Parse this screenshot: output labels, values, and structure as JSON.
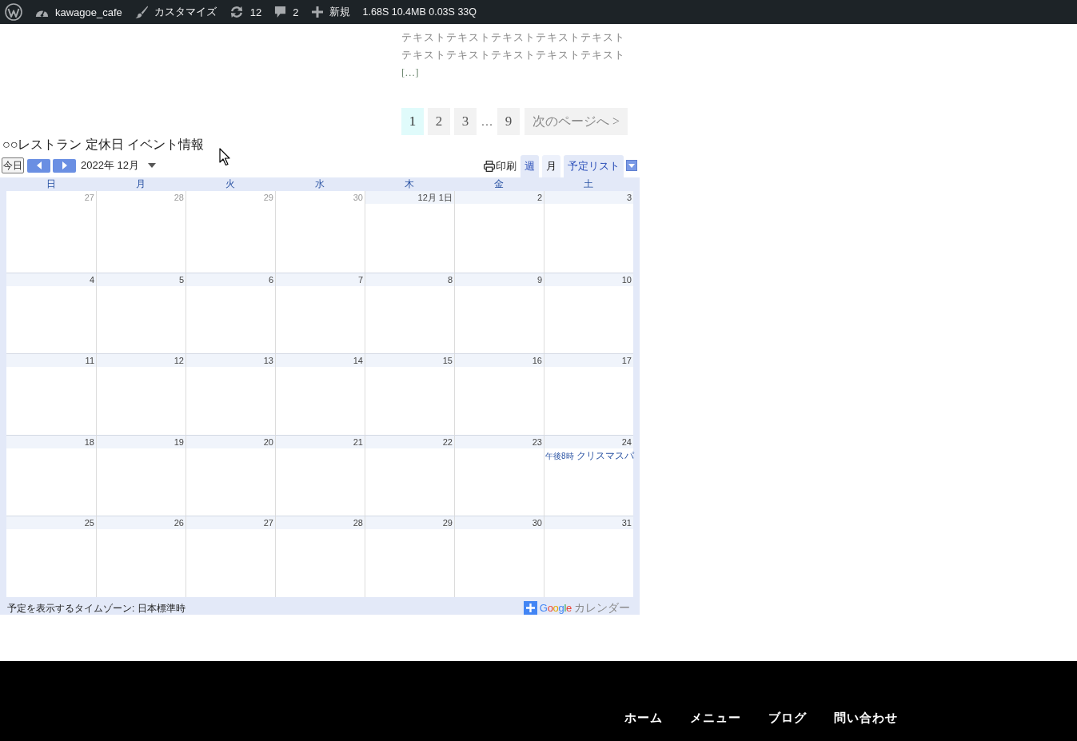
{
  "admin_bar": {
    "items": [
      {
        "kind": "site",
        "label": "kawagoe_cafe"
      },
      {
        "kind": "customize",
        "label": "カスタマイズ"
      },
      {
        "kind": "updates",
        "label": "12"
      },
      {
        "kind": "comments",
        "label": "2"
      },
      {
        "kind": "new",
        "label": "新規"
      }
    ],
    "stats": "1.68S 10.4MB 0.03S 33Q"
  },
  "post_excerpt": {
    "text": "テキストテキストテキストテキストテキストテキストテキストテキストテキストテキスト",
    "more": "[…]"
  },
  "pagination": {
    "items": [
      {
        "kind": "page",
        "label": "1",
        "selected": true
      },
      {
        "kind": "page",
        "label": "2",
        "selected": false
      },
      {
        "kind": "page",
        "label": "3",
        "selected": false
      },
      {
        "kind": "gap",
        "label": "…",
        "selected": false
      },
      {
        "kind": "page",
        "label": "9",
        "selected": false
      }
    ],
    "next": "次のページへ >"
  },
  "calendar": {
    "title": "○○レストラン 定休日 イベント情報",
    "toolbar": {
      "today": "今日",
      "date": "2022年 12月",
      "print": "印刷",
      "views": [
        {
          "label": "週",
          "selected": false
        },
        {
          "label": "月",
          "selected": true
        },
        {
          "label": "予定リスト",
          "selected": false
        }
      ]
    },
    "weekdays": [
      "日",
      "月",
      "火",
      "水",
      "木",
      "金",
      "土"
    ],
    "weeks": [
      [
        {
          "label": "27",
          "in_month": false
        },
        {
          "label": "28",
          "in_month": false
        },
        {
          "label": "29",
          "in_month": false
        },
        {
          "label": "30",
          "in_month": false
        },
        {
          "label": "12月 1日",
          "in_month": true
        },
        {
          "label": "2",
          "in_month": true
        },
        {
          "label": "3",
          "in_month": true
        }
      ],
      [
        {
          "label": "4",
          "in_month": true
        },
        {
          "label": "5",
          "in_month": true
        },
        {
          "label": "6",
          "in_month": true
        },
        {
          "label": "7",
          "in_month": true
        },
        {
          "label": "8",
          "in_month": true
        },
        {
          "label": "9",
          "in_month": true
        },
        {
          "label": "10",
          "in_month": true
        }
      ],
      [
        {
          "label": "11",
          "in_month": true
        },
        {
          "label": "12",
          "in_month": true
        },
        {
          "label": "13",
          "in_month": true
        },
        {
          "label": "14",
          "in_month": true
        },
        {
          "label": "15",
          "in_month": true
        },
        {
          "label": "16",
          "in_month": true
        },
        {
          "label": "17",
          "in_month": true
        }
      ],
      [
        {
          "label": "18",
          "in_month": true
        },
        {
          "label": "19",
          "in_month": true
        },
        {
          "label": "20",
          "in_month": true
        },
        {
          "label": "21",
          "in_month": true
        },
        {
          "label": "22",
          "in_month": true
        },
        {
          "label": "23",
          "in_month": true
        },
        {
          "label": "24",
          "in_month": true,
          "events": [
            {
              "time": "午後8時",
              "title": "クリスマスパ"
            }
          ]
        }
      ],
      [
        {
          "label": "25",
          "in_month": true
        },
        {
          "label": "26",
          "in_month": true
        },
        {
          "label": "27",
          "in_month": true
        },
        {
          "label": "28",
          "in_month": true
        },
        {
          "label": "29",
          "in_month": true
        },
        {
          "label": "30",
          "in_month": true
        },
        {
          "label": "31",
          "in_month": true
        }
      ]
    ],
    "timezone": "予定を表示するタイムゾーン: 日本標準時",
    "badge": {
      "brand": "Google",
      "label": "カレンダー"
    }
  },
  "footer_nav": [
    "ホーム",
    "メニュー",
    "ブログ",
    "問い合わせ"
  ]
}
